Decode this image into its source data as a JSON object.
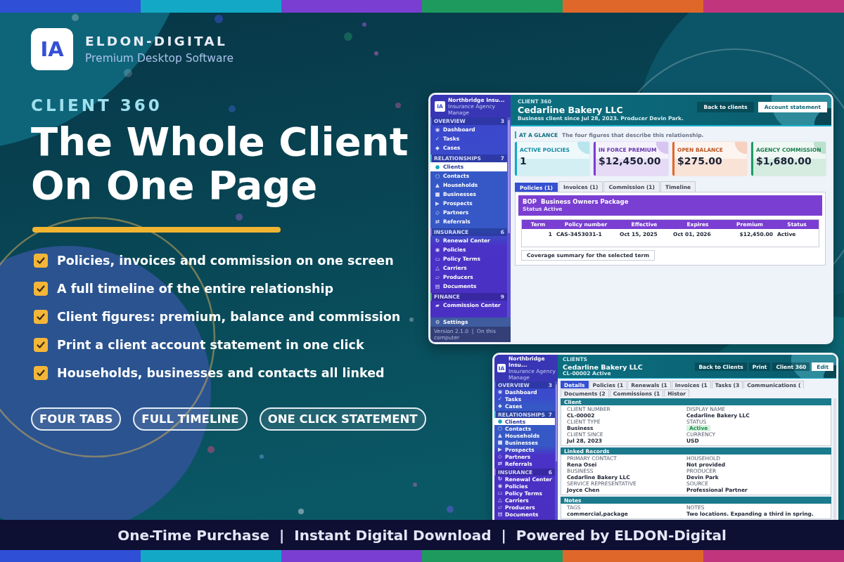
{
  "brand": {
    "logo": "IA",
    "name": "ELDON-DIGITAL",
    "tagline": "Premium Desktop Software"
  },
  "hero": {
    "eyebrow": "CLIENT 360",
    "title": "The Whole Client On One Page"
  },
  "features": [
    "Policies, invoices and commission on one screen",
    "A full timeline of the entire relationship",
    "Client figures: premium, balance and commission",
    "Print a client account statement in one click",
    "Households, businesses and contacts all linked"
  ],
  "tags": [
    "FOUR TABS",
    "FULL TIMELINE",
    "ONE CLICK STATEMENT"
  ],
  "client360_window": {
    "sidebar": {
      "logo": "IA",
      "app_name": "Northbridge Insu...",
      "app_subtitle": "Insurance Agency Manage",
      "sections": [
        {
          "title": "OVERVIEW",
          "count": "3",
          "color": "#3d5ce0",
          "items": [
            {
              "glyph": "◉",
              "label": "Dashboard",
              "selected": false
            },
            {
              "glyph": "✓",
              "label": "Tasks",
              "selected": false
            },
            {
              "glyph": "◆",
              "label": "Cases",
              "selected": false
            }
          ]
        },
        {
          "title": "RELATIONSHIPS",
          "count": "7",
          "color": "#19b3cf",
          "items": [
            {
              "glyph": "●",
              "label": "Clients",
              "selected": true
            },
            {
              "glyph": "○",
              "label": "Contacts",
              "selected": false
            },
            {
              "glyph": "▲",
              "label": "Households",
              "selected": false
            },
            {
              "glyph": "■",
              "label": "Businesses",
              "selected": false
            },
            {
              "glyph": "▶",
              "label": "Prospects",
              "selected": false
            },
            {
              "glyph": "◇",
              "label": "Partners",
              "selected": false
            },
            {
              "glyph": "⇄",
              "label": "Referrals",
              "selected": false
            }
          ]
        },
        {
          "title": "INSURANCE",
          "count": "6",
          "color": "#8b54e6",
          "items": [
            {
              "glyph": "↻",
              "label": "Renewal Center",
              "selected": false
            },
            {
              "glyph": "◉",
              "label": "Policies",
              "selected": false
            },
            {
              "glyph": "▭",
              "label": "Policy Terms",
              "selected": false
            },
            {
              "glyph": "△",
              "label": "Carriers",
              "selected": false
            },
            {
              "glyph": "▱",
              "label": "Producers",
              "selected": false
            },
            {
              "glyph": "▤",
              "label": "Documents",
              "selected": false
            }
          ]
        },
        {
          "title": "FINANCE",
          "count": "9",
          "color": "#22a860",
          "items": [
            {
              "glyph": "▰",
              "label": "Commission Center",
              "selected": false
            }
          ]
        }
      ],
      "settings": {
        "glyph": "⚙",
        "label": "Settings"
      },
      "footer": "Version 2.1.0  |  On this computer"
    },
    "header": {
      "eyebrow": "CLIENT 360",
      "title": "Cedarline Bakery LLC",
      "subtitle": "Business client since Jul 28, 2023. Producer Devin Park.",
      "buttons": [
        {
          "label": "Back to clients",
          "kind": "ghost"
        },
        {
          "label": "Account statement",
          "kind": "primary"
        }
      ]
    },
    "glance": {
      "label": "AT A GLANCE",
      "description": "The four figures that describe this relationship."
    },
    "stats": [
      {
        "label": "ACTIVE POLICIES",
        "value": "1",
        "color": "#14a8c4"
      },
      {
        "label": "IN FORCE PREMIUM",
        "value": "$12,450.00",
        "color": "#7a3fd2"
      },
      {
        "label": "OPEN BALANCE",
        "value": "$275.00",
        "color": "#e0672a"
      },
      {
        "label": "AGENCY COMMISSION",
        "value": "$1,680.00",
        "color": "#1f9a5e"
      }
    ],
    "tabs": [
      {
        "label": "Policies (1)",
        "selected": true
      },
      {
        "label": "Invoices (1)",
        "selected": false
      },
      {
        "label": "Commission (1)",
        "selected": false
      },
      {
        "label": "Timeline",
        "selected": false
      }
    ],
    "policy": {
      "code": "BOP",
      "name": "Business Owners Package",
      "status": "Status Active",
      "table": {
        "columns": [
          "Term",
          "Policy number",
          "Effective",
          "Expires",
          "Premium",
          "Status"
        ],
        "rows": [
          [
            "1",
            "CAS-3453031-1",
            "Oct 15, 2025",
            "Oct 01, 2026",
            "$12,450.00",
            "Active"
          ]
        ]
      }
    },
    "action_button": "Coverage summary for the selected term"
  },
  "detail_window": {
    "sidebar": {
      "logo": "IA",
      "app_name": "Northbridge Insu...",
      "app_subtitle": "Insurance Agency Manage",
      "sections": [
        {
          "title": "OVERVIEW",
          "count": "3",
          "color": "#3d5ce0",
          "items": [
            {
              "glyph": "◉",
              "label": "Dashboard",
              "selected": false
            },
            {
              "glyph": "✓",
              "label": "Tasks",
              "selected": false
            },
            {
              "glyph": "◆",
              "label": "Cases",
              "selected": false
            }
          ]
        },
        {
          "title": "RELATIONSHIPS",
          "count": "7",
          "color": "#19b3cf",
          "items": [
            {
              "glyph": "●",
              "label": "Clients",
              "selected": true
            },
            {
              "glyph": "○",
              "label": "Contacts",
              "selected": false
            },
            {
              "glyph": "▲",
              "label": "Households",
              "selected": false
            },
            {
              "glyph": "■",
              "label": "Businesses",
              "selected": false
            },
            {
              "glyph": "▶",
              "label": "Prospects",
              "selected": false
            },
            {
              "glyph": "◇",
              "label": "Partners",
              "selected": false
            },
            {
              "glyph": "⇄",
              "label": "Referrals",
              "selected": false
            }
          ]
        },
        {
          "title": "INSURANCE",
          "count": "6",
          "color": "#8b54e6",
          "items": [
            {
              "glyph": "↻",
              "label": "Renewal Center",
              "selected": false
            },
            {
              "glyph": "◉",
              "label": "Policies",
              "selected": false
            },
            {
              "glyph": "▭",
              "label": "Policy Terms",
              "selected": false
            },
            {
              "glyph": "△",
              "label": "Carriers",
              "selected": false
            },
            {
              "glyph": "▱",
              "label": "Producers",
              "selected": false
            },
            {
              "glyph": "▤",
              "label": "Documents",
              "selected": false
            }
          ]
        }
      ]
    },
    "header": {
      "eyebrow": "CLIENTS",
      "title": "Cedarline Bakery LLC",
      "subtitle": "CL-00002 Active",
      "buttons": [
        {
          "label": "Back to Clients",
          "kind": "ghost"
        },
        {
          "label": "Print",
          "kind": "ghost"
        },
        {
          "label": "Client 360",
          "kind": "ghost"
        },
        {
          "label": "Edit",
          "kind": "primary"
        }
      ]
    },
    "tabs": [
      {
        "label": "Details",
        "selected": true
      },
      {
        "label": "Policies (1",
        "selected": false
      },
      {
        "label": "Renewals (1",
        "selected": false
      },
      {
        "label": "Invoices (1",
        "selected": false
      },
      {
        "label": "Tasks (3",
        "selected": false
      },
      {
        "label": "Communications (",
        "selected": false
      },
      {
        "label": "Documents (2",
        "selected": false
      },
      {
        "label": "Commissions (1",
        "selected": false
      },
      {
        "label": "Histor",
        "selected": false
      }
    ],
    "sections": [
      {
        "title": "Client",
        "fields": [
          {
            "label": "CLIENT NUMBER",
            "value": "CL-00002",
            "kind": "text"
          },
          {
            "label": "DISPLAY NAME",
            "value": "Cedarline Bakery LLC",
            "kind": "text"
          },
          {
            "label": "CLIENT TYPE",
            "value": "Business",
            "kind": "text"
          },
          {
            "label": "STATUS",
            "value": "Active",
            "kind": "badge"
          },
          {
            "label": "CLIENT SINCE",
            "value": "Jul 28, 2023",
            "kind": "text"
          },
          {
            "label": "CURRENCY",
            "value": "USD",
            "kind": "text"
          }
        ]
      },
      {
        "title": "Linked Records",
        "fields": [
          {
            "label": "PRIMARY CONTACT",
            "value": "Rena Osei",
            "kind": "text"
          },
          {
            "label": "HOUSEHOLD",
            "value": "Not provided",
            "kind": "text"
          },
          {
            "label": "BUSINESS",
            "value": "Cedarline Bakery LLC",
            "kind": "text"
          },
          {
            "label": "PRODUCER",
            "value": "Devin Park",
            "kind": "text"
          },
          {
            "label": "SERVICE REPRESENTATIVE",
            "value": "Joyce Chen",
            "kind": "text"
          },
          {
            "label": "SOURCE",
            "value": "Professional Partner",
            "kind": "text"
          }
        ]
      },
      {
        "title": "Notes",
        "fields": [
          {
            "label": "TAGS",
            "value": "commercial,package",
            "kind": "text"
          },
          {
            "label": "NOTES",
            "value": "Two locations. Expanding a third in spring.",
            "kind": "text"
          }
        ]
      }
    ]
  },
  "footer": "One-Time Purchase  |  Instant Digital Download  |  Powered by ELDON-Digital"
}
